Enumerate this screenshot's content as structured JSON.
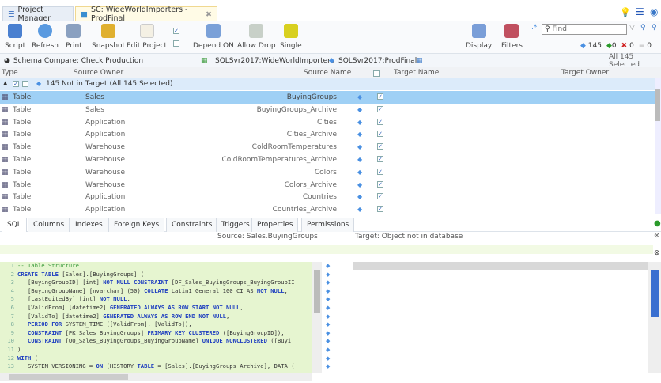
{
  "tabs": [
    {
      "label": "Project Manager"
    },
    {
      "label": "SC: WideWorldImporters - ProdFinal"
    }
  ],
  "toolbar": {
    "script": "Script",
    "refresh": "Refresh",
    "print": "Print",
    "snapshot": "Snapshot",
    "edit_project": "Edit Project",
    "depend_on": "Depend ON",
    "allow_drop": "Allow Drop",
    "single": "Single",
    "display": "Display",
    "filters": "Filters",
    "find_placeholder": "Find",
    "regex": ".*"
  },
  "counts": {
    "new": "145",
    "changed": "0",
    "removed": "0",
    "equal": "0"
  },
  "schema_bar": {
    "title": "Schema Compare: Check Production",
    "source": "SQLSvr2017:WideWorldImporters",
    "target": "SQLSvr2017:ProdFinal",
    "selected": "All 145 Selected"
  },
  "columns": {
    "type": "Type",
    "source_owner": "Source Owner",
    "source_name": "Source Name",
    "target_name": "Target Name",
    "target_owner": "Target Owner"
  },
  "group": {
    "label": "145 Not in Target (All 145 Selected)"
  },
  "rows": [
    {
      "type": "Table",
      "owner": "Sales",
      "name": "BuyingGroups"
    },
    {
      "type": "Table",
      "owner": "Sales",
      "name": "BuyingGroups_Archive"
    },
    {
      "type": "Table",
      "owner": "Application",
      "name": "Cities"
    },
    {
      "type": "Table",
      "owner": "Application",
      "name": "Cities_Archive"
    },
    {
      "type": "Table",
      "owner": "Warehouse",
      "name": "ColdRoomTemperatures"
    },
    {
      "type": "Table",
      "owner": "Warehouse",
      "name": "ColdRoomTemperatures_Archive"
    },
    {
      "type": "Table",
      "owner": "Warehouse",
      "name": "Colors"
    },
    {
      "type": "Table",
      "owner": "Warehouse",
      "name": "Colors_Archive"
    },
    {
      "type": "Table",
      "owner": "Application",
      "name": "Countries"
    },
    {
      "type": "Table",
      "owner": "Application",
      "name": "Countries_Archive"
    }
  ],
  "bottom_tabs": [
    "SQL",
    "Columns",
    "Indexes",
    "Foreign Keys",
    "Constraints",
    "Triggers",
    "Properties",
    "Permissions"
  ],
  "info": {
    "source": "Source: Sales.BuyingGroups",
    "target": "Target: Object not in database"
  },
  "code": [
    "-- Table Structure",
    "CREATE TABLE [Sales].[BuyingGroups] (",
    "   [BuyingGroupID] [int] NOT NULL CONSTRAINT [DF_Sales_BuyingGroups_BuyingGroupII",
    "   [BuyingGroupName] [nvarchar] (50) COLLATE Latin1_General_100_CI_AS NOT NULL,",
    "   [LastEditedBy] [int] NOT NULL,",
    "   [ValidFrom] [datetime2] GENERATED ALWAYS AS ROW START NOT NULL,",
    "   [ValidTo] [datetime2] GENERATED ALWAYS AS ROW END NOT NULL,",
    "   PERIOD FOR SYSTEM_TIME ([ValidFrom], [ValidTo]),",
    "   CONSTRAINT [PK_Sales_BuyingGroups] PRIMARY KEY CLUSTERED ([BuyingGroupID]),",
    "   CONSTRAINT [UQ_Sales_BuyingGroups_BuyingGroupName] UNIQUE NONCLUSTERED ([Buyi",
    ")",
    "WITH (",
    "   SYSTEM VERSIONING = ON (HISTORY TABLE = [Sales].[BuyingGroups Archive], DATA ("
  ]
}
